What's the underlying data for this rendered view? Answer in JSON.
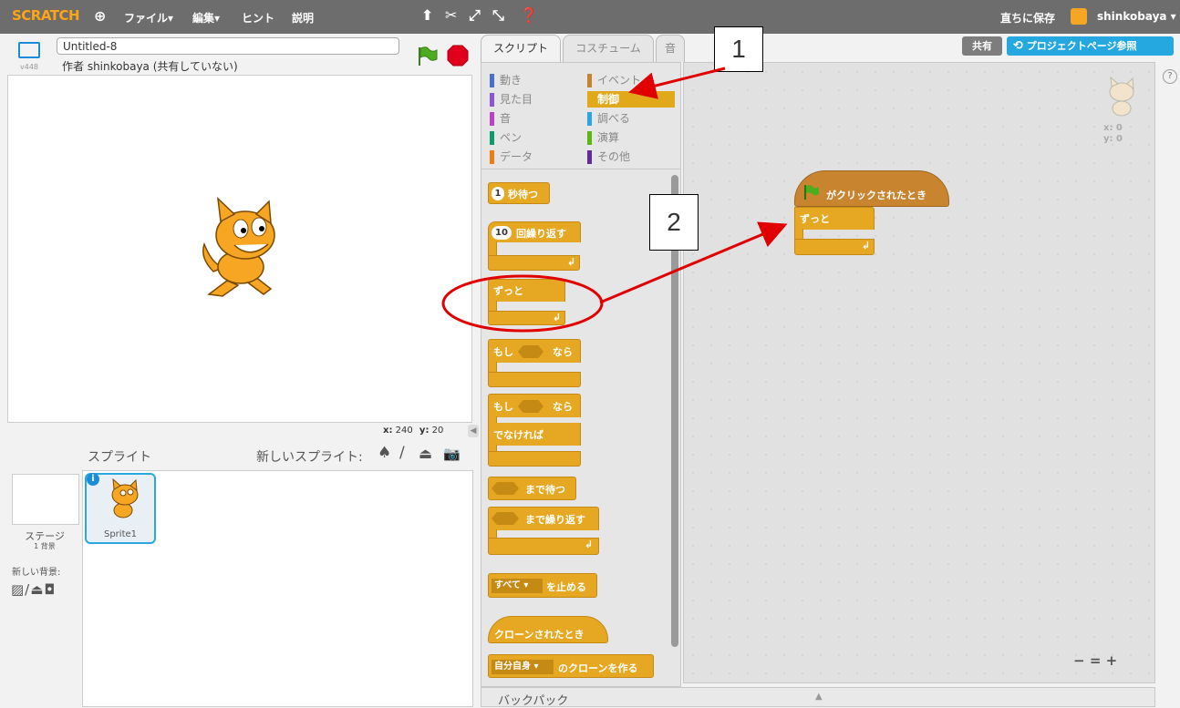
{
  "menubar": {
    "logo": "SCRATCH",
    "items": [
      "ファイル▾",
      "編集▾",
      "ヒント",
      "説明"
    ],
    "save_now": "直ちに保存",
    "user": "shinkobaya ▾"
  },
  "stage": {
    "version": "v448",
    "project_title": "Untitled-8",
    "author": "作者 shinkobaya (共有していない)",
    "coords_x_label": "x:",
    "coords_x": "240",
    "coords_y_label": "y:",
    "coords_y": "20"
  },
  "sprites": {
    "header": "スプライト",
    "new_sprite": "新しいスプライト:",
    "stage_label": "ステージ",
    "stage_sub": "1 背景",
    "new_backdrop": "新しい背景:",
    "sprite_name": "Sprite1"
  },
  "tabs": [
    "スクリプト",
    "コスチューム",
    "音"
  ],
  "categories": [
    {
      "label": "動き",
      "color": "#4a6cd4"
    },
    {
      "label": "イベント",
      "color": "#c88330"
    },
    {
      "label": "見た目",
      "color": "#8a55d7"
    },
    {
      "label": "制御",
      "color": "#e1a91a"
    },
    {
      "label": "音",
      "color": "#bb42c3"
    },
    {
      "label": "調べる",
      "color": "#2ca5e2"
    },
    {
      "label": "ペン",
      "color": "#0e9a6c"
    },
    {
      "label": "演算",
      "color": "#5cb712"
    },
    {
      "label": "データ",
      "color": "#ee7d16"
    },
    {
      "label": "その他",
      "color": "#632d99"
    }
  ],
  "blocks": {
    "wait": "秒待つ",
    "wait_val": "1",
    "repeat": "回繰り返す",
    "repeat_val": "10",
    "forever": "ずっと",
    "if_then_1": "もし",
    "if_then_2": "なら",
    "else": "でなければ",
    "wait_until": "まで待つ",
    "repeat_until": "まで繰り返す",
    "stop_all": "すべて",
    "stop_label": "を止める",
    "clone_start": "クローンされたとき",
    "create_clone_val": "自分自身",
    "create_clone": "のクローンを作る"
  },
  "script": {
    "hat": "がクリックされたとき",
    "forever": "ずっと",
    "sprite_x": "x: 0",
    "sprite_y": "y: 0"
  },
  "top_right": {
    "share": "共有",
    "see_project_page": "プロジェクトページ参照"
  },
  "backpack": "バックパック",
  "zoom": {
    "minus": "−",
    "reset": "=",
    "plus": "+"
  },
  "annotations": {
    "callout1": "1",
    "callout2": "2"
  },
  "colors": {
    "control": "#e6a822",
    "accent_blue": "#25a8e0",
    "arrow": "#e00000"
  }
}
